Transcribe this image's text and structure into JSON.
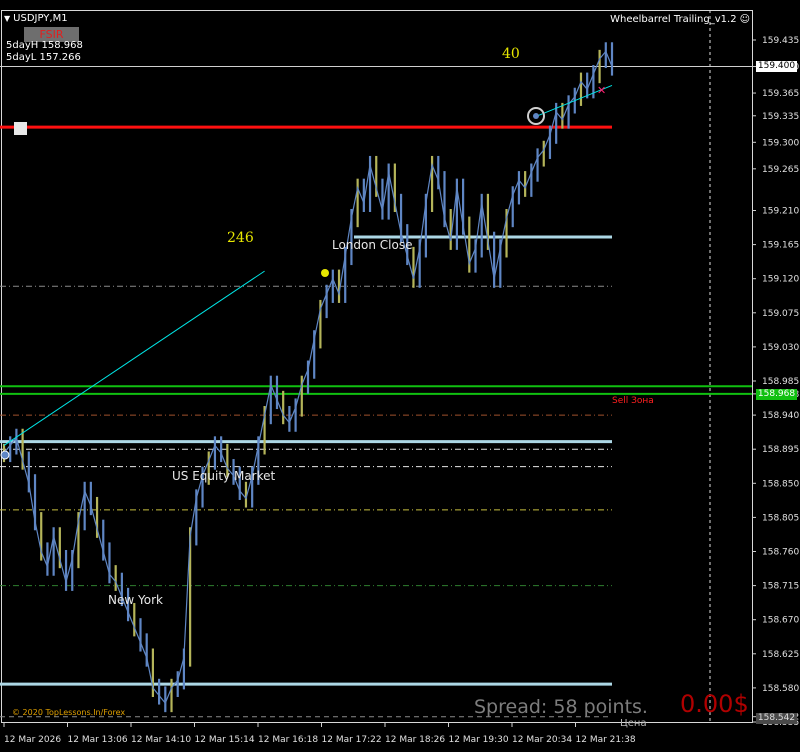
{
  "header": {
    "symbol": "USDJPY,M1",
    "indicator": "Wheelbarrel Trailing_v1.2",
    "fsir": "FSIR",
    "stat_high_label": "5dayH",
    "stat_high_value": "158.968",
    "stat_low_label": "5dayL",
    "stat_low_value": "157.266"
  },
  "footer": {
    "copyright": "© 2020 TopLessons.In/Forex",
    "spread": "Spread: 58 points.",
    "profit": "0.00$",
    "price_word": "Цена"
  },
  "annotations": {
    "count_top": "40",
    "count_mid": "246",
    "london_close": "London Close",
    "us_equity": "US Equity Market",
    "new_york": "New York",
    "sell_zone": "Sell Зона"
  },
  "price_tags": {
    "current": "159.400",
    "green": "158.968",
    "bottom": "158.542"
  },
  "colors": {
    "background": "#000000",
    "candles": "#5f86c4",
    "candles_alt": "#b5b55a",
    "current_line": "#cfcfcf",
    "red_level": "#ff1010",
    "green_level": "#10c010",
    "light_blue_level": "#add8e6",
    "trend_line": "#00e5e5"
  },
  "chart_data": {
    "type": "line",
    "title": "USDJPY,M1",
    "xlabel": "",
    "ylabel": "",
    "ylim": [
      158.535,
      159.435
    ],
    "grid": false,
    "yticks": [
      "159.435",
      "159.400",
      "159.365",
      "159.335",
      "159.300",
      "159.265",
      "159.210",
      "159.165",
      "159.120",
      "159.075",
      "159.030",
      "158.985",
      "158.968",
      "158.940",
      "158.895",
      "158.850",
      "158.805",
      "158.760",
      "158.715",
      "158.670",
      "158.625",
      "158.580",
      "158.542",
      "158.535"
    ],
    "xticks": [
      "12 Mar 2026",
      "12 Mar 13:06",
      "12 Mar 14:10",
      "12 Mar 15:14",
      "12 Mar 16:18",
      "12 Mar 17:22",
      "12 Mar 18:26",
      "12 Mar 19:30",
      "12 Mar 20:34",
      "12 Mar 21:38"
    ],
    "series": [
      {
        "values": [
          158.89,
          158.9,
          158.91,
          158.88,
          158.85,
          158.8,
          158.76,
          158.74,
          158.78,
          158.75,
          158.72,
          158.75,
          158.8,
          158.84,
          158.82,
          158.79,
          158.76,
          158.73,
          158.72,
          158.7,
          158.68,
          158.66,
          158.64,
          158.62,
          158.58,
          158.57,
          158.56,
          158.58,
          158.59,
          158.62,
          158.78,
          158.83,
          158.86,
          158.88,
          158.9,
          158.89,
          158.87,
          158.86,
          158.84,
          158.83,
          158.86,
          158.9,
          158.94,
          158.98,
          158.96,
          158.94,
          158.93,
          158.95,
          158.98,
          159.0,
          159.04,
          159.08,
          159.1,
          159.12,
          159.1,
          159.15,
          159.2,
          159.24,
          159.22,
          159.27,
          159.24,
          159.21,
          159.26,
          159.22,
          159.18,
          159.15,
          159.12,
          159.16,
          159.22,
          159.27,
          159.25,
          159.2,
          159.17,
          159.24,
          159.19,
          159.14,
          159.16,
          159.22,
          159.17,
          159.12,
          159.16,
          159.2,
          159.23,
          159.25,
          159.24,
          159.26,
          159.28,
          159.29,
          159.31,
          159.34,
          159.33,
          159.35,
          159.36,
          159.38,
          159.37,
          159.39,
          159.41,
          159.42,
          159.4
        ]
      }
    ],
    "levels": [
      {
        "value": 159.32,
        "style": "solid",
        "color": "red"
      },
      {
        "value": 159.175,
        "style": "solid",
        "color": "light-blue"
      },
      {
        "value": 159.11,
        "style": "dash-dot",
        "color": "gray"
      },
      {
        "value": 158.978,
        "style": "solid",
        "color": "green"
      },
      {
        "value": 158.968,
        "style": "solid",
        "color": "green"
      },
      {
        "value": 158.94,
        "style": "dash-dot",
        "color": "brown"
      },
      {
        "value": 158.905,
        "style": "solid",
        "color": "light-blue"
      },
      {
        "value": 158.895,
        "style": "dash-dot",
        "color": "white"
      },
      {
        "value": 158.872,
        "style": "dash-dot",
        "color": "white"
      },
      {
        "value": 158.815,
        "style": "dash-dot",
        "color": "olive"
      },
      {
        "value": 158.715,
        "style": "dash-dot",
        "color": "dark-green"
      },
      {
        "value": 158.585,
        "style": "solid",
        "color": "light-blue"
      },
      {
        "value": 158.542,
        "style": "dash",
        "color": "gray"
      }
    ],
    "trend_lines": [
      {
        "from": [
          0,
          158.9
        ],
        "to": [
          42,
          159.13
        ]
      },
      {
        "from": [
          86,
          159.335
        ],
        "to": [
          98,
          159.375
        ]
      }
    ]
  }
}
